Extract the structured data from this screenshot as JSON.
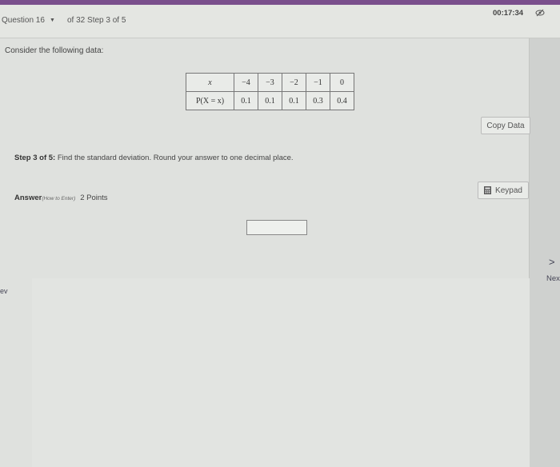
{
  "header": {
    "question_label": "Question 16",
    "of_step": "of 32 Step 3 of 5",
    "timer": "00:17:34"
  },
  "prompt": "Consider the following data:",
  "table": {
    "x_header": "x",
    "p_header": "P(X = x)",
    "x_values": [
      "−4",
      "−3",
      "−2",
      "−1",
      "0"
    ],
    "p_values": [
      "0.1",
      "0.1",
      "0.1",
      "0.3",
      "0.4"
    ]
  },
  "buttons": {
    "copy_data": "Copy Data",
    "keypad": "Keypad"
  },
  "step": {
    "label": "Step 3 of 5:",
    "text": " Find the standard deviation. Round your answer to one decimal place."
  },
  "answer": {
    "label": "Answer",
    "how_to": "(How to Enter)",
    "points": "2 Points",
    "value": ""
  },
  "nav": {
    "next_arrow": ">",
    "next": "Nex",
    "prev": "ev"
  },
  "colors": {
    "top_strip": "#7a4f8c",
    "background": "#dfe1de"
  }
}
